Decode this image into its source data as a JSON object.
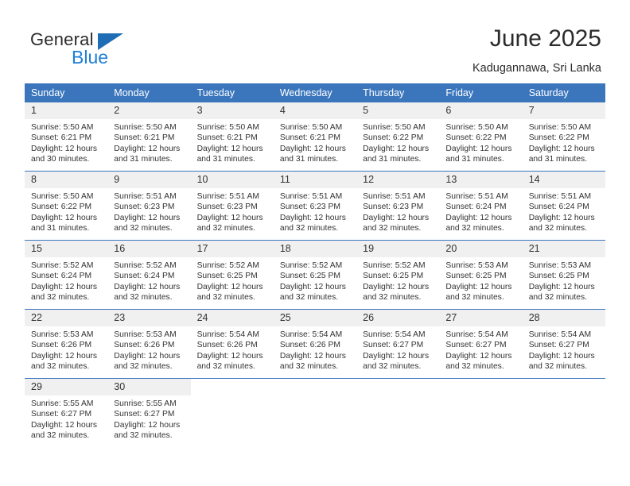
{
  "brand": {
    "name_part1": "General",
    "name_part2": "Blue",
    "triangle_color": "#1f6db4",
    "blue_color": "#1f7fd4"
  },
  "header": {
    "title": "June 2025",
    "subtitle": "Kadugannawa, Sri Lanka"
  },
  "theme": {
    "header_blue": "#3b76bd",
    "daynum_band": "#f0f0f0",
    "text": "#333333"
  },
  "weekdays": [
    "Sunday",
    "Monday",
    "Tuesday",
    "Wednesday",
    "Thursday",
    "Friday",
    "Saturday"
  ],
  "labels": {
    "sunrise_prefix": "Sunrise:",
    "sunset_prefix": "Sunset:",
    "daylight_prefix": "Daylight:"
  },
  "days": [
    {
      "n": "1",
      "sunrise": "Sunrise: 5:50 AM",
      "sunset": "Sunset: 6:21 PM",
      "daylight_l1": "Daylight: 12 hours",
      "daylight_l2": "and 30 minutes."
    },
    {
      "n": "2",
      "sunrise": "Sunrise: 5:50 AM",
      "sunset": "Sunset: 6:21 PM",
      "daylight_l1": "Daylight: 12 hours",
      "daylight_l2": "and 31 minutes."
    },
    {
      "n": "3",
      "sunrise": "Sunrise: 5:50 AM",
      "sunset": "Sunset: 6:21 PM",
      "daylight_l1": "Daylight: 12 hours",
      "daylight_l2": "and 31 minutes."
    },
    {
      "n": "4",
      "sunrise": "Sunrise: 5:50 AM",
      "sunset": "Sunset: 6:21 PM",
      "daylight_l1": "Daylight: 12 hours",
      "daylight_l2": "and 31 minutes."
    },
    {
      "n": "5",
      "sunrise": "Sunrise: 5:50 AM",
      "sunset": "Sunset: 6:22 PM",
      "daylight_l1": "Daylight: 12 hours",
      "daylight_l2": "and 31 minutes."
    },
    {
      "n": "6",
      "sunrise": "Sunrise: 5:50 AM",
      "sunset": "Sunset: 6:22 PM",
      "daylight_l1": "Daylight: 12 hours",
      "daylight_l2": "and 31 minutes."
    },
    {
      "n": "7",
      "sunrise": "Sunrise: 5:50 AM",
      "sunset": "Sunset: 6:22 PM",
      "daylight_l1": "Daylight: 12 hours",
      "daylight_l2": "and 31 minutes."
    },
    {
      "n": "8",
      "sunrise": "Sunrise: 5:50 AM",
      "sunset": "Sunset: 6:22 PM",
      "daylight_l1": "Daylight: 12 hours",
      "daylight_l2": "and 31 minutes."
    },
    {
      "n": "9",
      "sunrise": "Sunrise: 5:51 AM",
      "sunset": "Sunset: 6:23 PM",
      "daylight_l1": "Daylight: 12 hours",
      "daylight_l2": "and 32 minutes."
    },
    {
      "n": "10",
      "sunrise": "Sunrise: 5:51 AM",
      "sunset": "Sunset: 6:23 PM",
      "daylight_l1": "Daylight: 12 hours",
      "daylight_l2": "and 32 minutes."
    },
    {
      "n": "11",
      "sunrise": "Sunrise: 5:51 AM",
      "sunset": "Sunset: 6:23 PM",
      "daylight_l1": "Daylight: 12 hours",
      "daylight_l2": "and 32 minutes."
    },
    {
      "n": "12",
      "sunrise": "Sunrise: 5:51 AM",
      "sunset": "Sunset: 6:23 PM",
      "daylight_l1": "Daylight: 12 hours",
      "daylight_l2": "and 32 minutes."
    },
    {
      "n": "13",
      "sunrise": "Sunrise: 5:51 AM",
      "sunset": "Sunset: 6:24 PM",
      "daylight_l1": "Daylight: 12 hours",
      "daylight_l2": "and 32 minutes."
    },
    {
      "n": "14",
      "sunrise": "Sunrise: 5:51 AM",
      "sunset": "Sunset: 6:24 PM",
      "daylight_l1": "Daylight: 12 hours",
      "daylight_l2": "and 32 minutes."
    },
    {
      "n": "15",
      "sunrise": "Sunrise: 5:52 AM",
      "sunset": "Sunset: 6:24 PM",
      "daylight_l1": "Daylight: 12 hours",
      "daylight_l2": "and 32 minutes."
    },
    {
      "n": "16",
      "sunrise": "Sunrise: 5:52 AM",
      "sunset": "Sunset: 6:24 PM",
      "daylight_l1": "Daylight: 12 hours",
      "daylight_l2": "and 32 minutes."
    },
    {
      "n": "17",
      "sunrise": "Sunrise: 5:52 AM",
      "sunset": "Sunset: 6:25 PM",
      "daylight_l1": "Daylight: 12 hours",
      "daylight_l2": "and 32 minutes."
    },
    {
      "n": "18",
      "sunrise": "Sunrise: 5:52 AM",
      "sunset": "Sunset: 6:25 PM",
      "daylight_l1": "Daylight: 12 hours",
      "daylight_l2": "and 32 minutes."
    },
    {
      "n": "19",
      "sunrise": "Sunrise: 5:52 AM",
      "sunset": "Sunset: 6:25 PM",
      "daylight_l1": "Daylight: 12 hours",
      "daylight_l2": "and 32 minutes."
    },
    {
      "n": "20",
      "sunrise": "Sunrise: 5:53 AM",
      "sunset": "Sunset: 6:25 PM",
      "daylight_l1": "Daylight: 12 hours",
      "daylight_l2": "and 32 minutes."
    },
    {
      "n": "21",
      "sunrise": "Sunrise: 5:53 AM",
      "sunset": "Sunset: 6:25 PM",
      "daylight_l1": "Daylight: 12 hours",
      "daylight_l2": "and 32 minutes."
    },
    {
      "n": "22",
      "sunrise": "Sunrise: 5:53 AM",
      "sunset": "Sunset: 6:26 PM",
      "daylight_l1": "Daylight: 12 hours",
      "daylight_l2": "and 32 minutes."
    },
    {
      "n": "23",
      "sunrise": "Sunrise: 5:53 AM",
      "sunset": "Sunset: 6:26 PM",
      "daylight_l1": "Daylight: 12 hours",
      "daylight_l2": "and 32 minutes."
    },
    {
      "n": "24",
      "sunrise": "Sunrise: 5:54 AM",
      "sunset": "Sunset: 6:26 PM",
      "daylight_l1": "Daylight: 12 hours",
      "daylight_l2": "and 32 minutes."
    },
    {
      "n": "25",
      "sunrise": "Sunrise: 5:54 AM",
      "sunset": "Sunset: 6:26 PM",
      "daylight_l1": "Daylight: 12 hours",
      "daylight_l2": "and 32 minutes."
    },
    {
      "n": "26",
      "sunrise": "Sunrise: 5:54 AM",
      "sunset": "Sunset: 6:27 PM",
      "daylight_l1": "Daylight: 12 hours",
      "daylight_l2": "and 32 minutes."
    },
    {
      "n": "27",
      "sunrise": "Sunrise: 5:54 AM",
      "sunset": "Sunset: 6:27 PM",
      "daylight_l1": "Daylight: 12 hours",
      "daylight_l2": "and 32 minutes."
    },
    {
      "n": "28",
      "sunrise": "Sunrise: 5:54 AM",
      "sunset": "Sunset: 6:27 PM",
      "daylight_l1": "Daylight: 12 hours",
      "daylight_l2": "and 32 minutes."
    },
    {
      "n": "29",
      "sunrise": "Sunrise: 5:55 AM",
      "sunset": "Sunset: 6:27 PM",
      "daylight_l1": "Daylight: 12 hours",
      "daylight_l2": "and 32 minutes."
    },
    {
      "n": "30",
      "sunrise": "Sunrise: 5:55 AM",
      "sunset": "Sunset: 6:27 PM",
      "daylight_l1": "Daylight: 12 hours",
      "daylight_l2": "and 32 minutes."
    }
  ]
}
